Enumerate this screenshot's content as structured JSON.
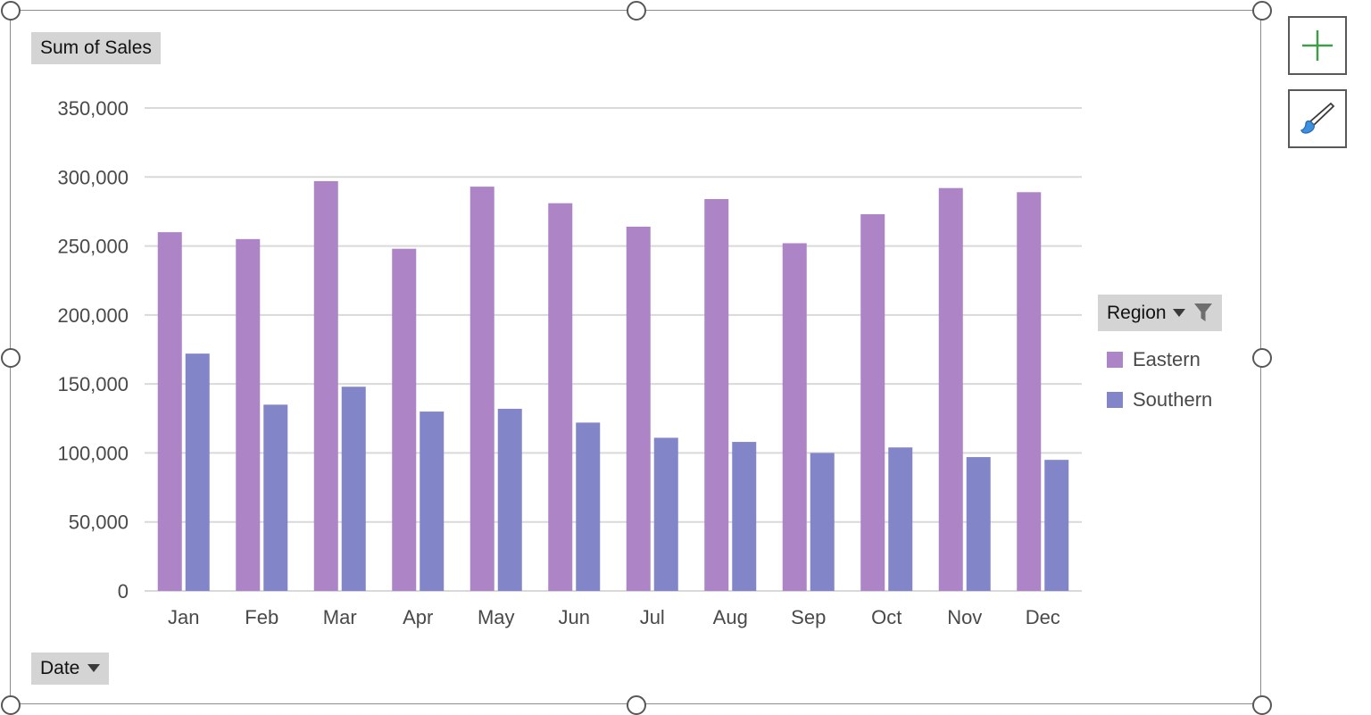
{
  "chart_object": {
    "selected": true,
    "value_field_button": {
      "label": "Sum of Sales"
    },
    "axis_field_button": {
      "label": "Date",
      "caret": "chevron-down-icon"
    },
    "legend": {
      "field_button": {
        "label": "Region",
        "caret": "chevron-down-icon",
        "filter_icon": "filter-icon"
      },
      "entries": [
        {
          "label": "Eastern",
          "color": "#ad84c6"
        },
        {
          "label": "Southern",
          "color": "#8385c9"
        }
      ]
    }
  },
  "side_buttons": [
    {
      "name": "chart-elements-button",
      "icon": "plus-icon",
      "color": "#3f9d4a"
    },
    {
      "name": "chart-styles-button",
      "icon": "paintbrush-icon",
      "color": "#2f7fd1"
    }
  ],
  "chart_data": {
    "type": "bar",
    "title": "",
    "xlabel": "Date",
    "ylabel": "Sum of Sales",
    "categories": [
      "Jan",
      "Feb",
      "Mar",
      "Apr",
      "May",
      "Jun",
      "Jul",
      "Aug",
      "Sep",
      "Oct",
      "Nov",
      "Dec"
    ],
    "series": [
      {
        "name": "Eastern",
        "color": "#ad84c6",
        "values": [
          260000,
          255000,
          297000,
          248000,
          293000,
          281000,
          264000,
          284000,
          252000,
          273000,
          292000,
          289000
        ]
      },
      {
        "name": "Southern",
        "color": "#8385c9",
        "values": [
          172000,
          135000,
          148000,
          130000,
          132000,
          122000,
          111000,
          108000,
          100000,
          104000,
          97000,
          95000
        ]
      }
    ],
    "ylim": [
      0,
      350000
    ],
    "yticks": [
      0,
      50000,
      100000,
      150000,
      200000,
      250000,
      300000,
      350000
    ],
    "ytick_labels": [
      "0",
      "50,000",
      "100,000",
      "150,000",
      "200,000",
      "250,000",
      "300,000",
      "350,000"
    ],
    "grid": true,
    "grid_color": "#d9d9d9",
    "legend_position": "right",
    "legend_entries": [
      "Eastern",
      "Southern"
    ]
  }
}
